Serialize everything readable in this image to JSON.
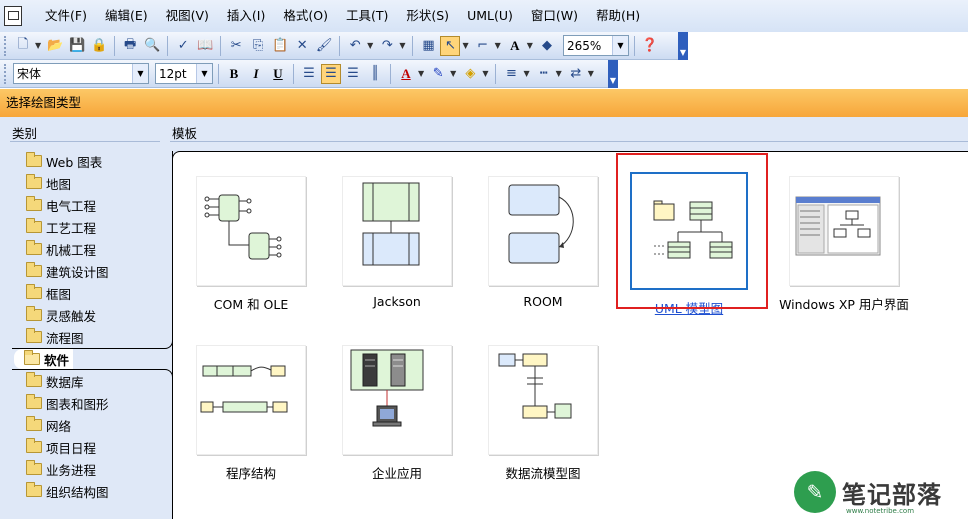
{
  "menu": [
    "文件(F)",
    "编辑(E)",
    "视图(V)",
    "插入(I)",
    "格式(O)",
    "工具(T)",
    "形状(S)",
    "UML(U)",
    "窗口(W)",
    "帮助(H)"
  ],
  "toolbar1": {
    "zoom": "265%"
  },
  "toolbar2": {
    "font": "宋体",
    "size": "12pt",
    "bold": "B",
    "italic": "I",
    "underline": "U"
  },
  "panel": {
    "header": "选择绘图类型",
    "category_title": "类别",
    "template_title": "模板"
  },
  "categories": [
    "Web 图表",
    "地图",
    "电气工程",
    "工艺工程",
    "机械工程",
    "建筑设计图",
    "框图",
    "灵感触发",
    "流程图",
    "软件",
    "数据库",
    "图表和图形",
    "网络",
    "项目日程",
    "业务进程",
    "组织结构图"
  ],
  "selected_category": "软件",
  "templates": [
    "COM 和 OLE",
    "Jackson",
    "ROOM",
    "UML 模型图",
    "Windows XP 用户界面",
    "程序结构",
    "企业应用",
    "数据流模型图"
  ],
  "selected_template": "UML 模型图",
  "watermark": {
    "text": "笔记部落",
    "sub": "www.notetribe.com",
    "icon": "pen-icon"
  }
}
